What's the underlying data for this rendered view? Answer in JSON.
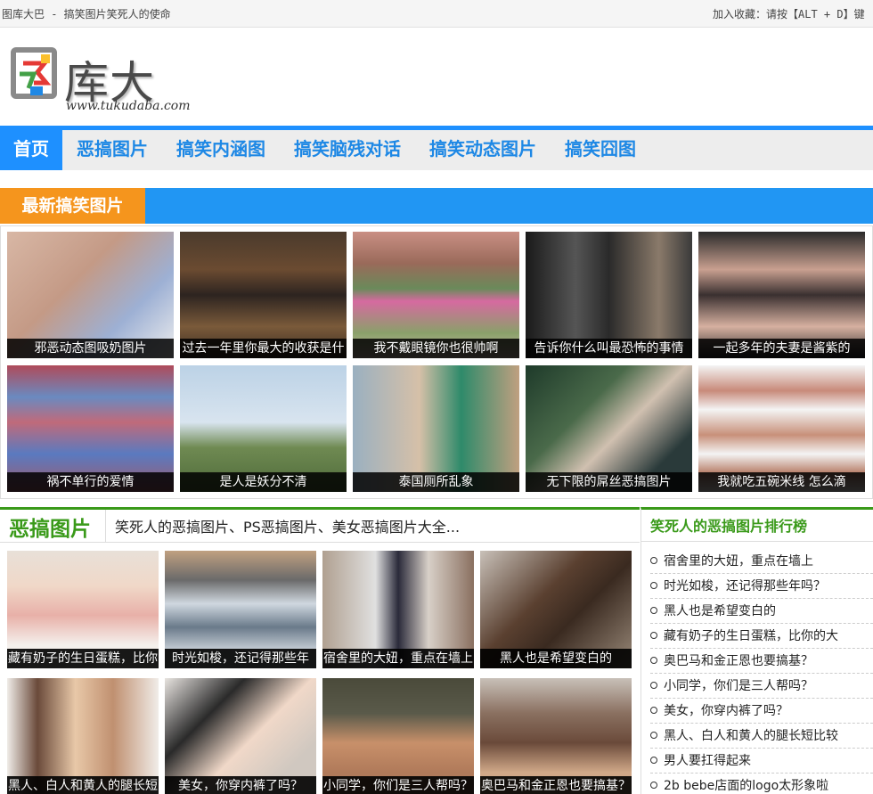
{
  "topbar": {
    "site_text": "图库大巴 - 搞笑图片笑死人的使命",
    "favorite_text": "加入收藏：请按【ALT + D】键"
  },
  "logo": {
    "name": "库大巴",
    "url": "www.tukudaba.com"
  },
  "nav": [
    "首页",
    "恶搞图片",
    "搞笑内涵图",
    "搞笑脑残对话",
    "搞笑动态图片",
    "搞笑囧图"
  ],
  "latest": {
    "title": "最新搞笑图片",
    "items": [
      "邪恶动态图吸奶图片",
      "过去一年里你最大的收获是什",
      "我不戴眼镜你也很帅啊",
      "告诉你什么叫最恐怖的事情",
      "一起多年的夫妻是酱紫的",
      "祸不单行的爱情",
      "是人是妖分不清",
      "泰国厕所乱象",
      "无下限的屌丝恶搞图片",
      "我就吃五碗米线 怎么滴"
    ]
  },
  "egao": {
    "title": "恶搞图片",
    "subtitle": "笑死人的恶搞图片、PS恶搞图片、美女恶搞图片大全...",
    "items": [
      "藏有奶子的生日蛋糕，比你",
      "时光如梭，还记得那些年",
      "宿舍里的大妞，重点在墙上",
      "黑人也是希望变白的",
      "黑人、白人和黄人的腿长短",
      "美女，你穿内裤了吗？",
      "小同学，你们是三人帮吗？",
      "奥巴马和金正恩也要搞基？"
    ]
  },
  "ranking": {
    "title": "笑死人的恶搞图片排行榜",
    "items": [
      "宿舍里的大妞，重点在墙上",
      "时光如梭，还记得那些年吗？",
      "黑人也是希望变白的",
      "藏有奶子的生日蛋糕，比你的大",
      "奥巴马和金正恩也要搞基？",
      "小同学，你们是三人帮吗？",
      "美女，你穿内裤了吗？",
      "黑人、白人和黄人的腿长短比较",
      "男人要扛得起来",
      "2b bebe店面的logo太形象啦"
    ]
  },
  "colors": {
    "nav_blue": "#1e90ff",
    "section_orange": "#f5951d",
    "section_green": "#3a9a1a"
  }
}
